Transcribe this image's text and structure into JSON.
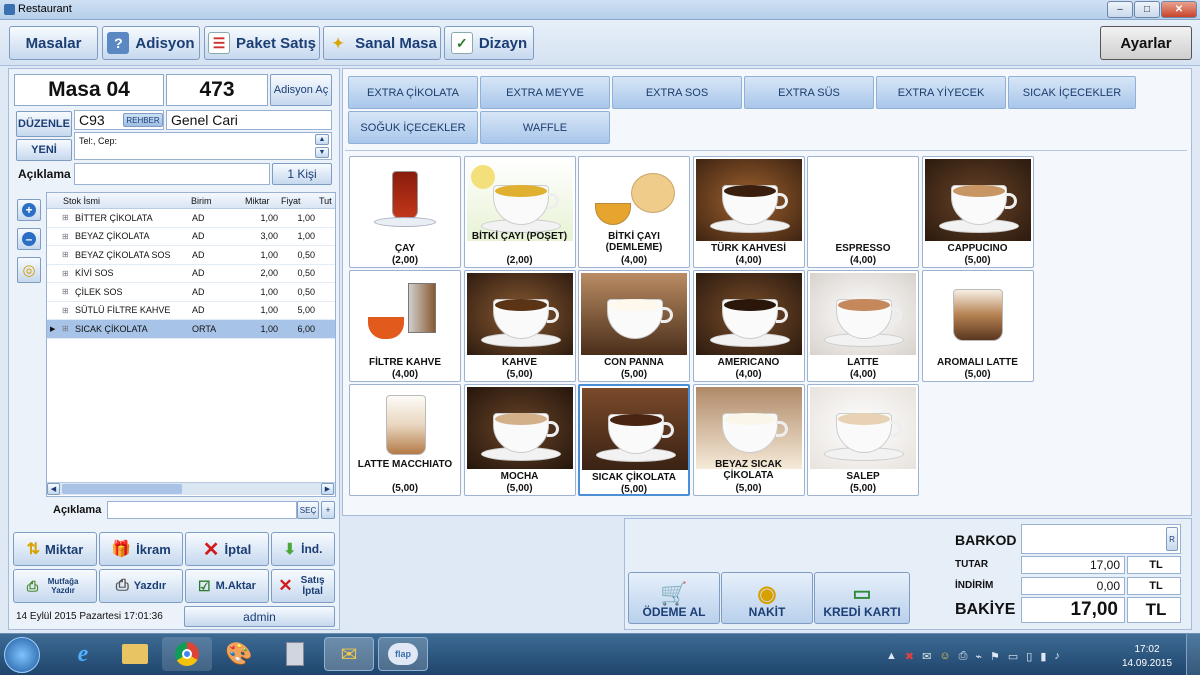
{
  "window": {
    "title": "Restaurant"
  },
  "toolbar": {
    "masalar": "Masalar",
    "adisyon": "Adisyon",
    "paket": "Paket Satış",
    "sanal": "Sanal Masa",
    "dizayn": "Dizayn",
    "ayarlar": "Ayarlar"
  },
  "order": {
    "table": "Masa 04",
    "number": "473",
    "adisyon_ac": "Adisyon Aç",
    "duzenle": "DÜZENLE",
    "yeni": "YENİ",
    "code": "C93",
    "rehber": "REHBER",
    "customer": "Genel Cari",
    "contact": "Tel:, Cep:",
    "aciklama_label": "Açıklama",
    "kisi": "1 Kişi"
  },
  "grid": {
    "headers": [
      "Stok İsmi",
      "Birim",
      "Miktar",
      "Fiyat",
      "Tut"
    ],
    "rows": [
      {
        "name": "BİTTER ÇİKOLATA",
        "unit": "AD",
        "qty": "1,00",
        "price": "1,00"
      },
      {
        "name": "BEYAZ ÇİKOLATA",
        "unit": "AD",
        "qty": "3,00",
        "price": "1,00"
      },
      {
        "name": "BEYAZ ÇİKOLATA SOS",
        "unit": "AD",
        "qty": "1,00",
        "price": "0,50"
      },
      {
        "name": "KİVİ SOS",
        "unit": "AD",
        "qty": "2,00",
        "price": "0,50"
      },
      {
        "name": "ÇİLEK SOS",
        "unit": "AD",
        "qty": "1,00",
        "price": "0,50"
      },
      {
        "name": "SÜTLÜ FİLTRE KAHVE",
        "unit": "AD",
        "qty": "1,00",
        "price": "5,00"
      },
      {
        "name": "SICAK ÇİKOLATA",
        "unit": "ORTA",
        "qty": "1,00",
        "price": "6,00"
      }
    ],
    "aciklama_label": "Açıklama",
    "sec": "SEÇ"
  },
  "actions": {
    "miktar": "Miktar",
    "ikram": "İkram",
    "iptal": "İptal",
    "ind": "İnd.",
    "mutfaga": "Mutfağa Yazdır",
    "yazdir": "Yazdır",
    "maktar": "M.Aktar",
    "satis_iptal": "Satış İptal"
  },
  "status": {
    "datetime": "14 Eylül 2015 Pazartesi 17:01:36",
    "user": "admin"
  },
  "categories": [
    "EXTRA ÇİKOLATA",
    "EXTRA MEYVE",
    "EXTRA SOS",
    "EXTRA SÜS",
    "EXTRA YİYECEK",
    "SICAK İÇECEKLER",
    "SOĞUK İÇECEKLER",
    "WAFFLE"
  ],
  "products": [
    {
      "name": "ÇAY",
      "price": "(2,00)",
      "image": "tea-glass"
    },
    {
      "name": "BİTKİ ÇAYI (POŞET)",
      "price": "(2,00)",
      "image": "herbal-tea-cup"
    },
    {
      "name": "BİTKİ ÇAYI (DEMLEME)",
      "price": "(4,00)",
      "image": "herbal-teapot"
    },
    {
      "name": "TÜRK KAHVESİ",
      "price": "(4,00)",
      "image": "turkish-coffee"
    },
    {
      "name": "ESPRESSO",
      "price": "(4,00)",
      "image": ""
    },
    {
      "name": "CAPPUCINO",
      "price": "(5,00)",
      "image": "cappuccino"
    },
    {
      "name": "FİLTRE KAHVE",
      "price": "(4,00)",
      "image": "french-press"
    },
    {
      "name": "KAHVE",
      "price": "(5,00)",
      "image": "coffee-cup"
    },
    {
      "name": "CON PANNA",
      "price": "(5,00)",
      "image": "con-panna"
    },
    {
      "name": "AMERICANO",
      "price": "(4,00)",
      "image": "americano"
    },
    {
      "name": "LATTE",
      "price": "(4,00)",
      "image": "latte-art"
    },
    {
      "name": "AROMALI LATTE",
      "price": "(5,00)",
      "image": "flavored-latte"
    },
    {
      "name": "LATTE MACCHIATO",
      "price": "(5,00)",
      "image": "latte-macchiato"
    },
    {
      "name": "MOCHA",
      "price": "(5,00)",
      "image": "mocha"
    },
    {
      "name": "SICAK ÇİKOLATA",
      "price": "(5,00)",
      "image": "hot-chocolate"
    },
    {
      "name": "BEYAZ SICAK ÇİKOLATA",
      "price": "(5,00)",
      "image": "white-hot-chocolate"
    },
    {
      "name": "SALEP",
      "price": "(5,00)",
      "image": "salep"
    }
  ],
  "totals": {
    "barkod_label": "BARKOD",
    "r": "R",
    "tutar_label": "TUTAR",
    "tutar": "17,00",
    "indirim_label": "İNDİRİM",
    "indirim": "0,00",
    "tl": "TL",
    "bakiye_label": "BAKİYE",
    "bakiye": "17,00"
  },
  "payment": {
    "odeme": "ÖDEME AL",
    "nakit": "NAKİT",
    "kredi": "KREDİ KARTI"
  },
  "taskbar": {
    "time": "17:02",
    "date": "14.09.2015",
    "flap": "flap"
  }
}
